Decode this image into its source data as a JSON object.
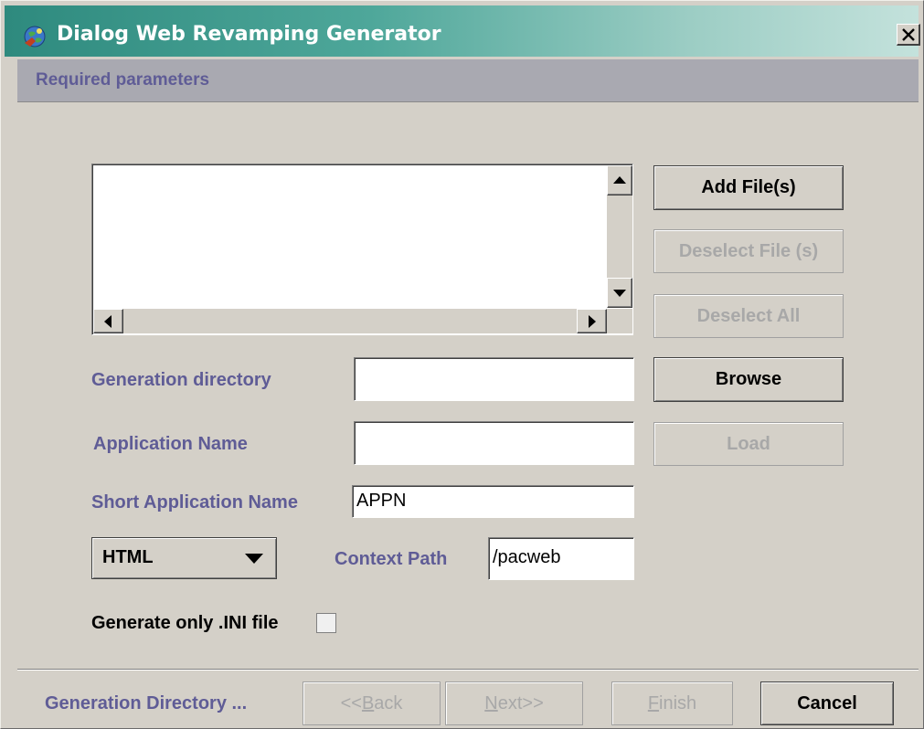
{
  "window": {
    "title": "Dialog Web Revamping Generator",
    "title_gradient": [
      "#2e8a7e",
      "#c4e2dc"
    ],
    "close_icon": "close-x-icon"
  },
  "header": {
    "section_title": "Required parameters"
  },
  "file_list": {
    "items": []
  },
  "buttons": {
    "add_files": "Add File(s)",
    "deselect_files": "Deselect File (s)",
    "deselect_all": "Deselect All",
    "browse": "Browse",
    "load": "Load"
  },
  "form": {
    "generation_directory": {
      "label": "Generation directory",
      "value": ""
    },
    "application_name": {
      "label": "Application Name",
      "value": ""
    },
    "short_application_name": {
      "label": "Short Application Name",
      "value": "APPN"
    },
    "output_type": {
      "selected": "HTML"
    },
    "context_path": {
      "label": "Context Path",
      "value": "/pacweb"
    },
    "generate_ini_only": {
      "label": "Generate only .INI file",
      "checked": false
    }
  },
  "footer": {
    "status": "Generation Directory ...",
    "back_prefix": "<<",
    "back_mnemonic": "B",
    "back_rest": "ack",
    "next_mnemonic": "N",
    "next_rest": "ext>>",
    "finish_mnemonic": "F",
    "finish_rest": "inish",
    "cancel": "Cancel"
  },
  "colors": {
    "label_text": "#5f5c96",
    "disabled_text": "#a8a8a8",
    "dialog_bg": "#d4d0c8"
  }
}
